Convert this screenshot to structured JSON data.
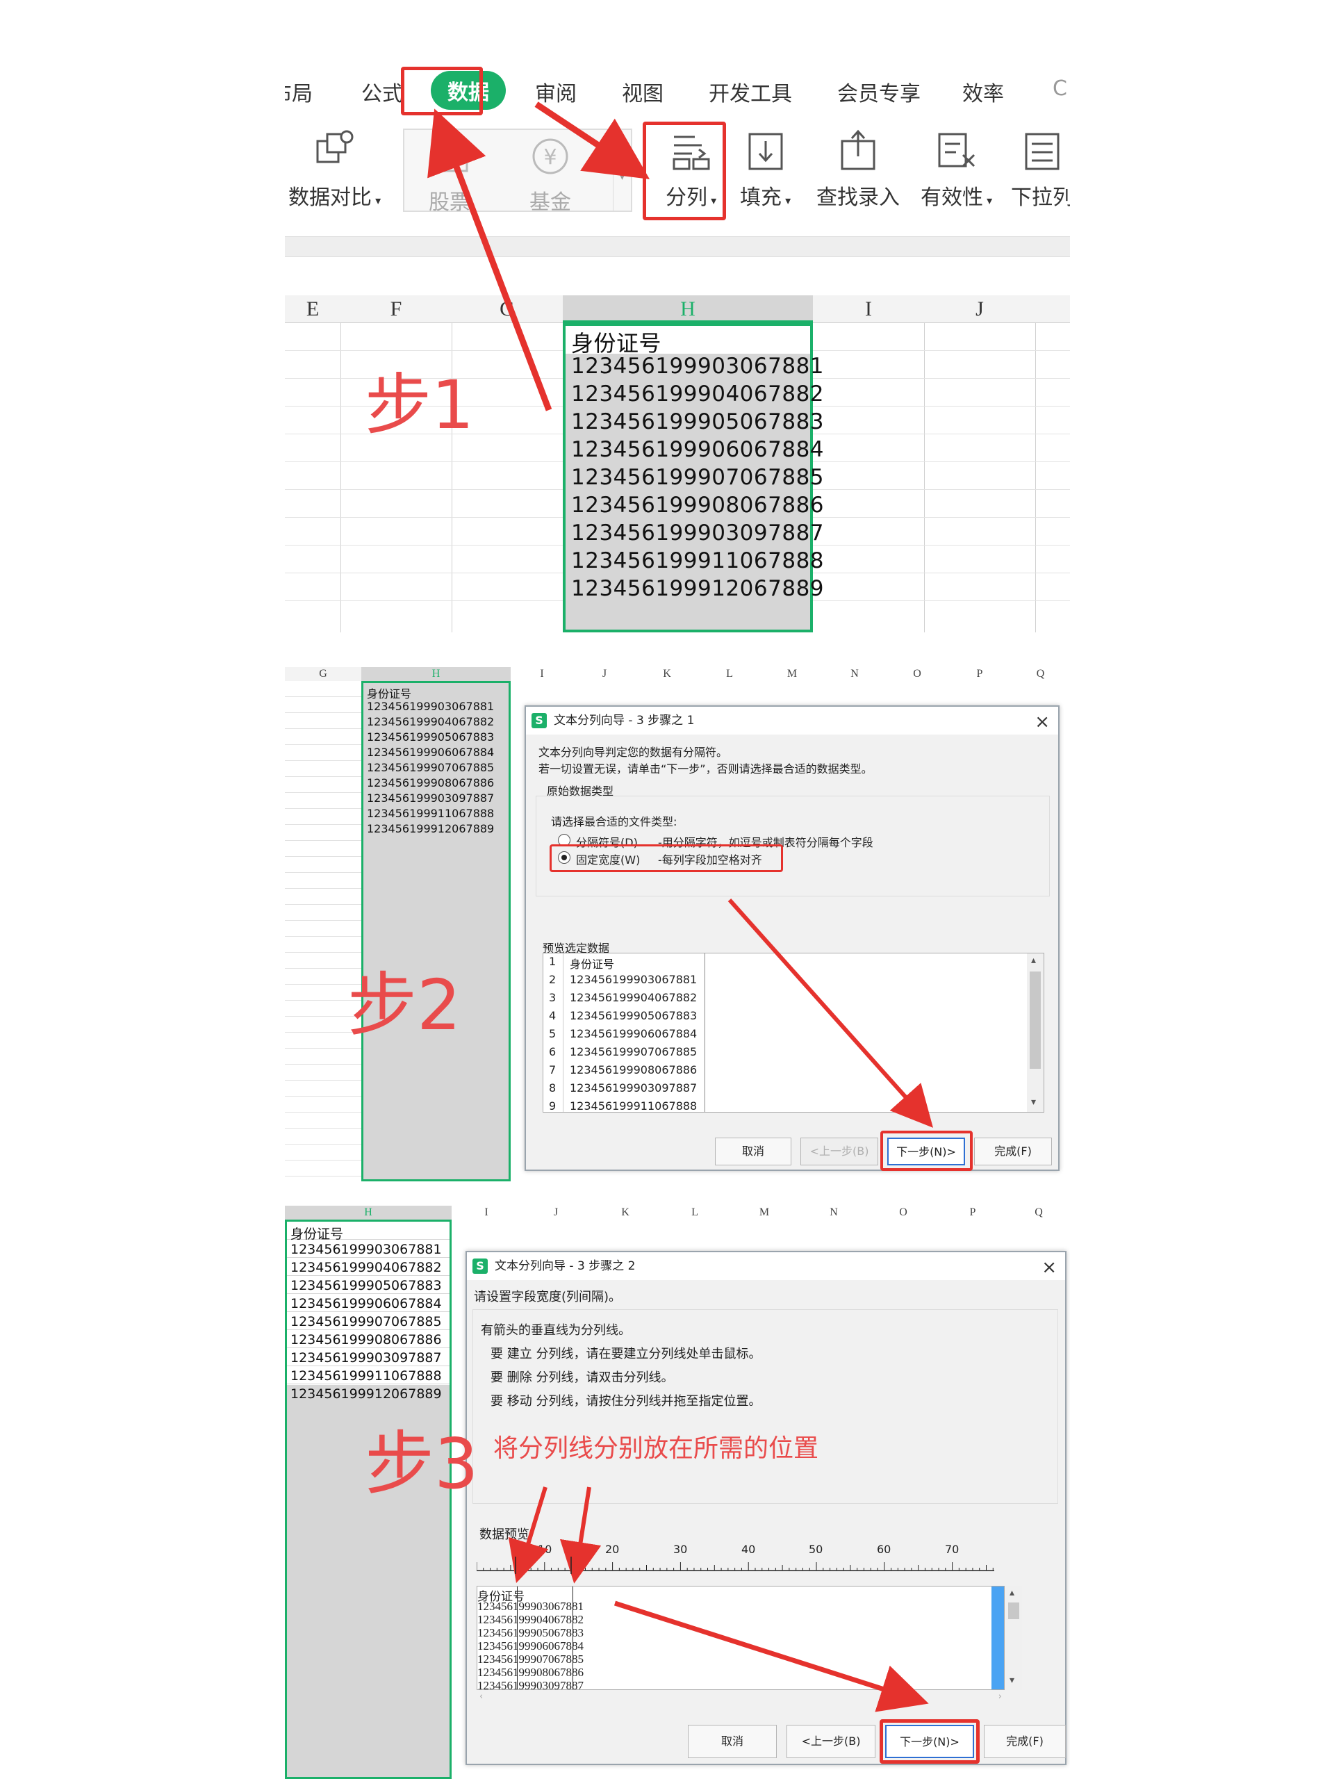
{
  "colors": {
    "accent_green": "#1bb069",
    "annotation_red": "#e5322d",
    "step_text": "#e94b4b",
    "selection_gray": "#d6d6d6"
  },
  "panel1": {
    "tabs": [
      "布局",
      "公式",
      "数据",
      "审阅",
      "视图",
      "开发工具",
      "会员专享",
      "效率"
    ],
    "active_tab": "数据",
    "ribbon": {
      "data_compare": "数据对比",
      "stock": "股票",
      "fund": "基金",
      "split": "分列",
      "fill": "填充",
      "lookup_entry": "查找录入",
      "validity": "有效性",
      "dropdown": "下拉列"
    },
    "columns": [
      "E",
      "F",
      "G",
      "H",
      "I",
      "J"
    ],
    "step_label": "步1"
  },
  "id_header": "身份证号",
  "ids": [
    "123456199903067881",
    "123456199904067882",
    "123456199905067883",
    "123456199906067884",
    "123456199907067885",
    "123456199908067886",
    "123456199903097887",
    "123456199911067888",
    "123456199912067889"
  ],
  "panel2": {
    "columns": [
      "G",
      "H",
      "I",
      "J",
      "K",
      "L",
      "M",
      "N",
      "O",
      "P",
      "Q"
    ],
    "step_label": "步2",
    "dialog": {
      "title": "文本分列向导 - 3 步骤之 1",
      "line1": "文本分列向导判定您的数据有分隔符。",
      "line2": "若一切设置无误，请单击“下一步”，否则请选择最合适的数据类型。",
      "group_title": "原始数据类型",
      "choose_label": "请选择最合适的文件类型:",
      "opt_delimited": "分隔符号(D)",
      "opt_delimited_desc": "-用分隔字符，如逗号或制表符分隔每个字段",
      "opt_fixed": "固定宽度(W)",
      "opt_fixed_desc": "-每列字段加空格对齐",
      "preview_label": "预览选定数据",
      "row_numbers": [
        "1",
        "2",
        "3",
        "4",
        "5",
        "6",
        "7",
        "8",
        "9"
      ],
      "buttons": {
        "cancel": "取消",
        "back": "<上一步(B)",
        "next": "下一步(N)>",
        "finish": "完成(F)"
      }
    }
  },
  "panel3": {
    "columns": [
      "H",
      "I",
      "J",
      "K",
      "L",
      "M",
      "N",
      "O",
      "P",
      "Q"
    ],
    "step_label": "步3",
    "annotation": "将分列线分别放在所需的位置",
    "dialog": {
      "title": "文本分列向导 - 3 步骤之 2",
      "prompt": "请设置字段宽度(列间隔)。",
      "info1": "有箭头的垂直线为分列线。",
      "info2": "要 建立 分列线，请在要建立分列线处单击鼠标。",
      "info3": "要 删除 分列线，请双击分列线。",
      "info4": "要 移动 分列线，请按住分列线并拖至指定位置。",
      "preview_label": "数据预览",
      "ruler": [
        "10",
        "20",
        "30",
        "40",
        "50",
        "60",
        "70"
      ],
      "buttons": {
        "cancel": "取消",
        "back": "<上一步(B)",
        "next": "下一步(N)>",
        "finish": "完成(F)"
      }
    }
  }
}
